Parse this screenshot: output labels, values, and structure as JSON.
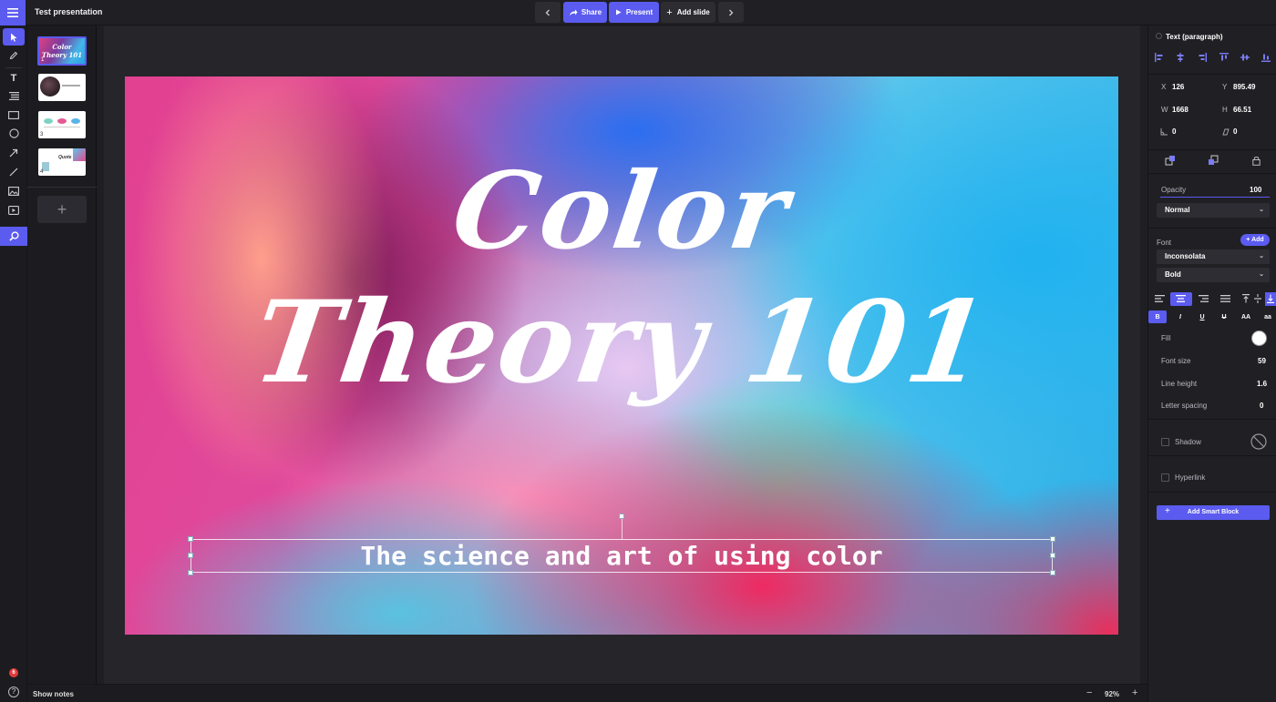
{
  "app": {
    "document_title": "Test presentation"
  },
  "toolbar": {
    "prev_icon": "chevron-left-icon",
    "share_label": "Share",
    "present_label": "Present",
    "add_slide_label": "Add slide",
    "next_icon": "chevron-right-icon"
  },
  "tools": [
    "select-icon",
    "pen-icon",
    "text-icon",
    "list-icon",
    "rectangle-icon",
    "ellipse-icon",
    "arrow-icon",
    "line-icon",
    "image-icon",
    "video-icon",
    "search-icon"
  ],
  "thumbnails": [
    {
      "num": "1",
      "label": "Color Theory 101",
      "selected": true
    },
    {
      "num": "2",
      "label": ""
    },
    {
      "num": "3",
      "label": ""
    },
    {
      "num": "4",
      "label": "Quote"
    }
  ],
  "slide": {
    "title_line1": "Color",
    "title_line2": "Theory 101",
    "subtitle": "The science and art of using color"
  },
  "bottom": {
    "notifications_count": "6",
    "show_notes_label": "Show notes",
    "zoom_minus": "−",
    "zoom_level": "92%",
    "zoom_plus": "+"
  },
  "inspector": {
    "element_type": "Text (paragraph)",
    "x_label": "X",
    "x_value": "126",
    "y_label": "Y",
    "y_value": "895.49",
    "w_label": "W",
    "w_value": "1668",
    "h_label": "H",
    "h_value": "66.51",
    "rotation_value": "0",
    "skew_value": "0",
    "opacity_label": "Opacity",
    "opacity_value": "100",
    "blend_mode": "Normal",
    "font_label": "Font",
    "font_add_label": "+ Add",
    "font_family": "Inconsolata",
    "font_weight": "Bold",
    "format_bold": "B",
    "format_italic": "I",
    "format_underline": "U",
    "format_strike": "U",
    "format_upper": "AA",
    "format_lower": "aa",
    "fill_label": "Fill",
    "fill_color": "#ffffff",
    "font_size_label": "Font size",
    "font_size_value": "59",
    "line_height_label": "Line height",
    "line_height_value": "1.6",
    "letter_spacing_label": "Letter spacing",
    "letter_spacing_value": "0",
    "shadow_label": "Shadow",
    "hyperlink_label": "Hyperlink",
    "smart_block_label": "Add Smart Block",
    "smart_block_icon": "+"
  },
  "colors": {
    "accent": "#5b5bf0",
    "panel": "#202024",
    "canvas": "#25252a"
  }
}
